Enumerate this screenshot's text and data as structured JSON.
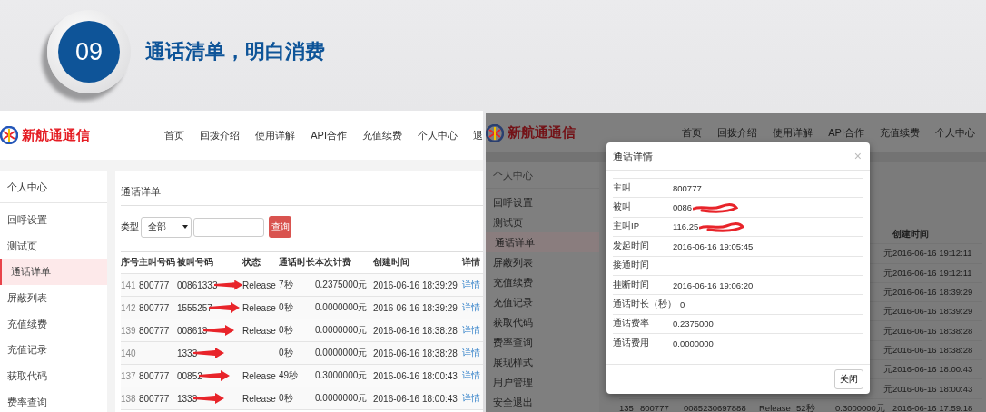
{
  "slide": {
    "number": "09",
    "title": "通话清单，明白消费"
  },
  "left_screenshot": {
    "brand": "新航通通信",
    "nav": [
      "首页",
      "回拨介绍",
      "使用详解",
      "API合作",
      "充值续费",
      "个人中心",
      "退"
    ],
    "sidebar": {
      "heading": "个人中心",
      "items": [
        {
          "label": "回呼设置",
          "selected": false
        },
        {
          "label": "测试页",
          "selected": false
        },
        {
          "label": "通话详单",
          "selected": true
        },
        {
          "label": "屏蔽列表",
          "selected": false
        },
        {
          "label": "充值续费",
          "selected": false
        },
        {
          "label": "充值记录",
          "selected": false
        },
        {
          "label": "获取代码",
          "selected": false
        },
        {
          "label": "费率查询",
          "selected": false
        }
      ]
    },
    "content": {
      "title": "通话详单",
      "filter": {
        "label": "类型",
        "select": "全部",
        "button": "查询"
      },
      "table": {
        "columns": [
          "序号",
          "主叫号码",
          "被叫号码",
          "状态",
          "通话时长",
          "本次计费",
          "创建时间",
          "详情"
        ],
        "rows": [
          {
            "id": "141",
            "caller": "800777",
            "callee": "00861333",
            "redacted": true,
            "status": "Release",
            "duration": "7秒",
            "charge": "0.2375000元",
            "created": "2016-06-16 18:39:29",
            "link": "详情"
          },
          {
            "id": "142",
            "caller": "800777",
            "callee": "1555257",
            "redacted": true,
            "status": "Release",
            "duration": "0秒",
            "charge": "0.0000000元",
            "created": "2016-06-16 18:39:29",
            "link": "详情"
          },
          {
            "id": "139",
            "caller": "800777",
            "callee": "008613",
            "redacted": true,
            "status": "Release",
            "duration": "0秒",
            "charge": "0.0000000元",
            "created": "2016-06-16 18:38:28",
            "link": "详情"
          },
          {
            "id": "140",
            "caller": "",
            "callee": "1333",
            "redacted": true,
            "status": "",
            "duration": "0秒",
            "charge": "0.0000000元",
            "created": "2016-06-16 18:38:28",
            "link": "详情"
          },
          {
            "id": "137",
            "caller": "800777",
            "callee": "00852",
            "redacted": true,
            "status": "Release",
            "duration": "49秒",
            "charge": "0.3000000元",
            "created": "2016-06-16 18:00:43",
            "link": "详情"
          },
          {
            "id": "138",
            "caller": "800777",
            "callee": "1333",
            "redacted": true,
            "status": "Release",
            "duration": "0秒",
            "charge": "0.0000000元",
            "created": "2016-06-16 18:00:43",
            "link": "详情"
          }
        ]
      }
    }
  },
  "right_screenshot": {
    "brand": "新航通通信",
    "nav": [
      "首页",
      "回拨介绍",
      "使用详解",
      "API合作",
      "充值续费",
      "个人中心"
    ],
    "sidebar": {
      "heading": "个人中心",
      "items": [
        {
          "label": "回呼设置",
          "selected": false
        },
        {
          "label": "测试页",
          "selected": false
        },
        {
          "label": "通话详单",
          "selected": true
        },
        {
          "label": "屏蔽列表",
          "selected": false
        },
        {
          "label": "充值续费",
          "selected": false
        },
        {
          "label": "充值记录",
          "selected": false
        },
        {
          "label": "获取代码",
          "selected": false
        },
        {
          "label": "费率查询",
          "selected": false
        },
        {
          "label": "展现样式",
          "selected": false
        },
        {
          "label": "用户管理",
          "selected": false
        },
        {
          "label": "安全退出",
          "selected": false
        }
      ]
    },
    "background_table": {
      "header": [
        "创建时间"
      ],
      "rows": [
        {
          "cells": [
            "元",
            "2016-06-16 19:12:11"
          ]
        },
        {
          "cells": [
            "元",
            "2016-06-16 19:12:11"
          ]
        },
        {
          "cells": [
            "元",
            "2016-06-16 18:39:29"
          ]
        },
        {
          "cells": [
            "元",
            "2016-06-16 18:39:29"
          ]
        },
        {
          "cells": [
            "元",
            "2016-06-16 18:38:28"
          ]
        },
        {
          "cells": [
            "元",
            "2016-06-16 18:38:28"
          ]
        },
        {
          "cells": [
            "元",
            "2016-06-16 18:00:43"
          ]
        },
        {
          "cells": [
            "元",
            "2016-06-16 18:00:43"
          ]
        },
        {
          "cells": [
            "135",
            "800777",
            "0085230697888",
            "Release",
            "52秒",
            "0.3000000元",
            "2016-06-16 17:59:18"
          ]
        }
      ]
    },
    "dialog": {
      "title": "通话详情",
      "close": "×",
      "fields": [
        {
          "label": "主叫",
          "value": "800777",
          "redacted": false
        },
        {
          "label": "被叫",
          "value": "0086",
          "redacted": true
        },
        {
          "label": "主叫IP",
          "value": "116.25",
          "redacted": true
        },
        {
          "label": "发起时间",
          "value": "2016-06-16 19:05:45",
          "redacted": false
        },
        {
          "label": "接通时间",
          "redacted": false
        },
        {
          "label": "挂断时间",
          "value": "2016-06-16 19:06:20",
          "redacted": false
        },
        {
          "label": "通话时长（秒）",
          "value": "0",
          "redacted": false
        },
        {
          "label": "通话费率",
          "value": "0.2375000",
          "redacted": false
        },
        {
          "label": "通话费用",
          "value": "0.0000000",
          "redacted": false
        }
      ],
      "button": "关闭"
    }
  }
}
